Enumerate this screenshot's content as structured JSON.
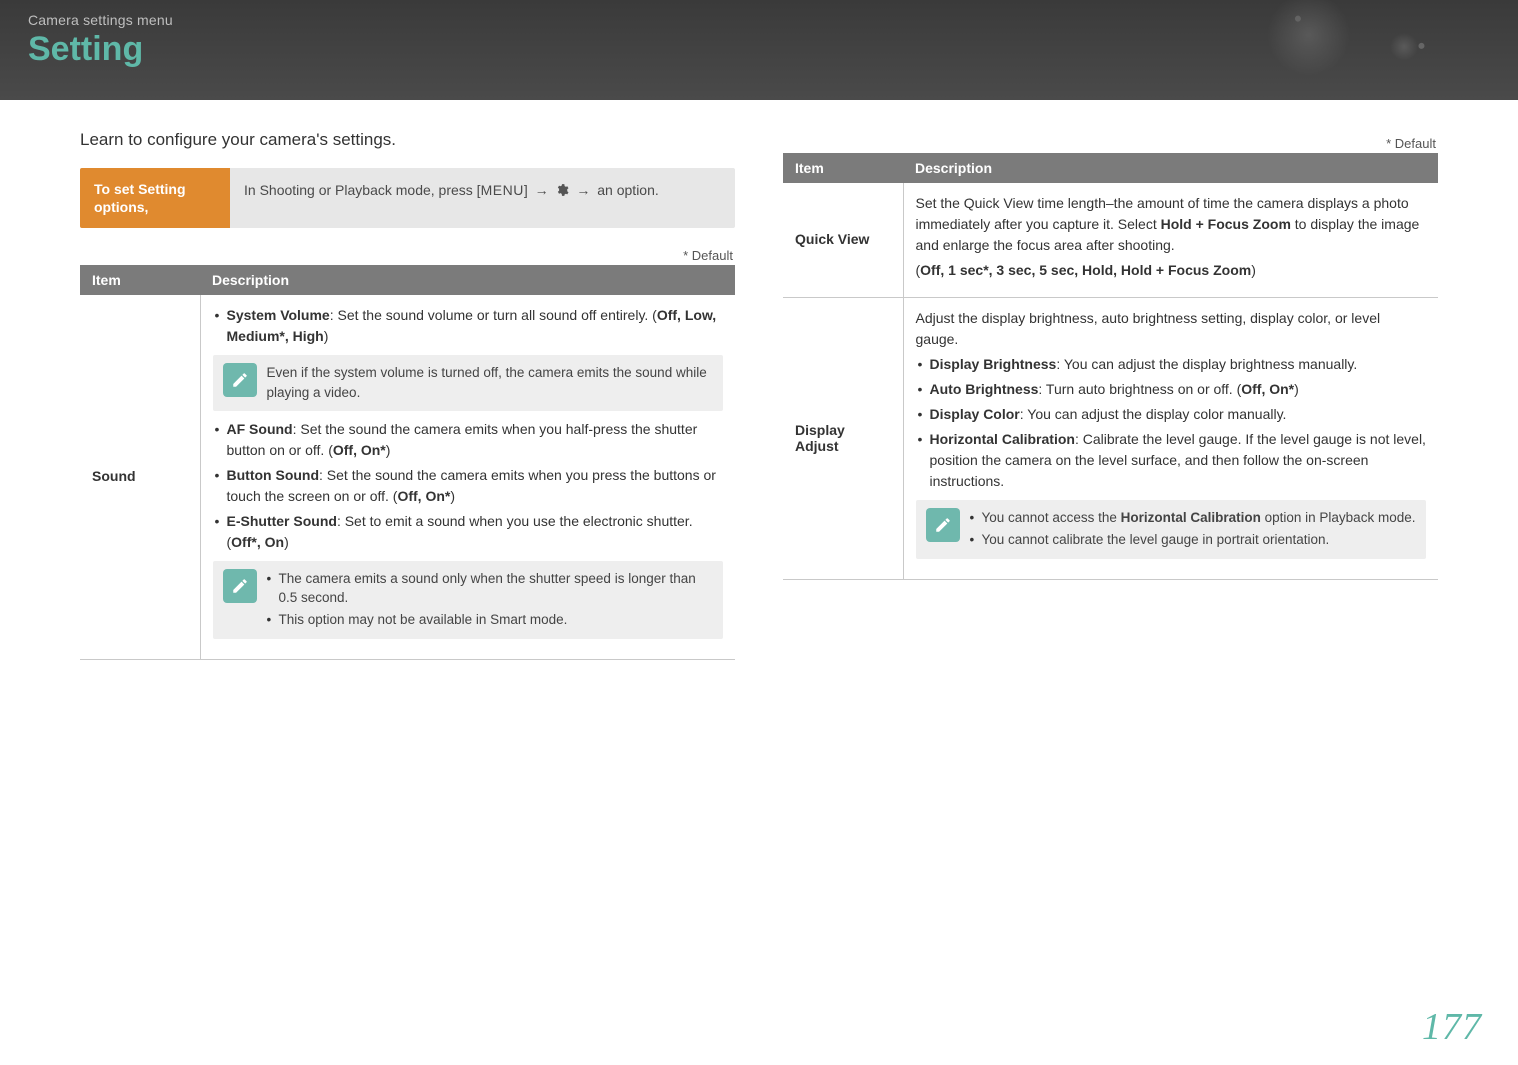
{
  "header": {
    "crumb": "Camera settings menu",
    "title": "Setting"
  },
  "intro": "Learn to configure your camera's settings.",
  "step": {
    "label": "To set Setting options,",
    "body_pre": "In Shooting or Playback mode, press [",
    "body_menu": "MENU",
    "body_arrow": "→",
    "body_post": "an option."
  },
  "default_label": "* Default",
  "table_headers": {
    "item": "Item",
    "description": "Description"
  },
  "left": {
    "sound": {
      "item": "Sound",
      "sysvol_label": "System Volume",
      "sysvol_text": ": Set the sound volume or turn all sound off entirely. (",
      "sysvol_opts": "Off, Low, Medium*, High",
      "sysvol_close": ")",
      "note1": "Even if the system volume is turned off, the camera emits the sound while playing a video.",
      "af_label": "AF Sound",
      "af_text": ": Set the sound the camera emits when you half-press the shutter button on or off. (",
      "af_opts": "Off, On*",
      "af_close": ")",
      "btn_label": "Button Sound",
      "btn_text": ": Set the sound the camera emits when you press the buttons or touch the screen on or off. (",
      "btn_opts": "Off, On*",
      "btn_close": ")",
      "esh_label": "E-Shutter Sound",
      "esh_text": ": Set to emit a sound when you use the electronic shutter. (",
      "esh_opts": "Off*, On",
      "esh_close": ")",
      "note2a": "The camera emits a sound only when the shutter speed is longer than 0.5 second.",
      "note2b": "This option may not be available in Smart mode."
    }
  },
  "right": {
    "quickview": {
      "item": "Quick View",
      "text_pre": "Set the Quick View time length–the amount of time the camera displays a photo immediately after you capture it. Select ",
      "hfz": "Hold + Focus Zoom",
      "text_post": " to display the image and enlarge the focus area after shooting.",
      "opts_open": "(",
      "opts": "Off, 1 sec*, 3 sec, 5 sec, Hold, Hold + Focus Zoom",
      "opts_close": ")"
    },
    "display": {
      "item": "Display Adjust",
      "lead": "Adjust the display brightness, auto brightness setting, display color, or level gauge.",
      "db_label": "Display Brightness",
      "db_text": ": You can adjust the display brightness manually.",
      "ab_label": "Auto Brightness",
      "ab_text": ": Turn auto brightness on or off. (",
      "ab_opts": "Off, On*",
      "ab_close": ")",
      "dc_label": "Display Color",
      "dc_text": ": You can adjust the display color manually.",
      "hc_label": "Horizontal Calibration",
      "hc_text": ": Calibrate the level gauge. If the level gauge is not level, position the camera on the level surface, and then follow the on-screen instructions.",
      "note_a_pre": "You cannot access the ",
      "note_a_bold": "Horizontal Calibration",
      "note_a_post": " option in Playback mode.",
      "note_b": "You cannot calibrate the level gauge in portrait orientation."
    }
  },
  "page_number": "177"
}
